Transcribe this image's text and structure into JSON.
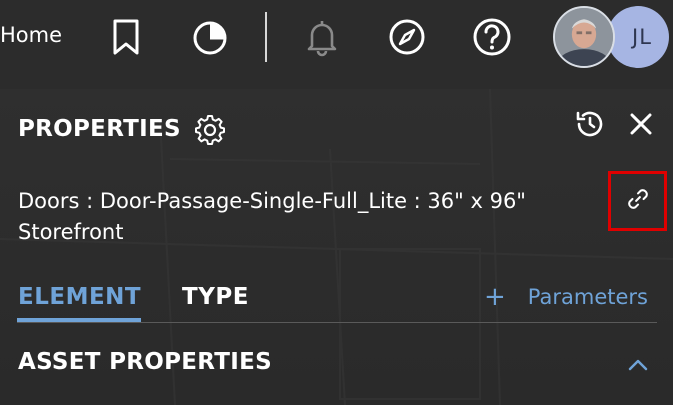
{
  "nav": {
    "home_label": "Home",
    "icons": [
      "bookmark-icon",
      "chart-icon",
      "bell-icon",
      "compass-icon",
      "help-icon"
    ],
    "user_initials": "JL"
  },
  "panel": {
    "title": "PROPERTIES",
    "element_name": "Doors : Door-Passage-Single-Full_Lite : 36\" x 96\" Storefront",
    "tabs": [
      {
        "label": "ELEMENT",
        "active": true
      },
      {
        "label": "TYPE",
        "active": false
      }
    ],
    "add_parameters_plus": "+",
    "add_parameters_label": "Parameters",
    "section_title": "ASSET PROPERTIES"
  },
  "colors": {
    "accent": "#6fa3d8",
    "highlight_box": "#e00000",
    "avatar_bg": "#a6b5e3"
  }
}
